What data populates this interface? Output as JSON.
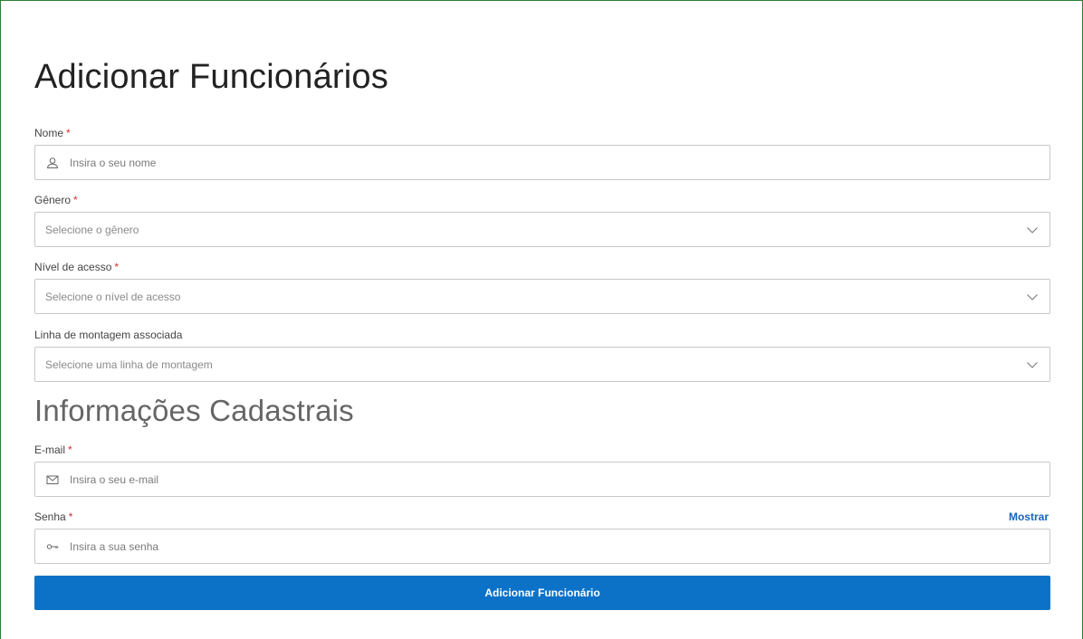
{
  "page": {
    "title": "Adicionar Funcionários",
    "section_title": "Informações Cadastrais"
  },
  "form": {
    "required_mark": "*",
    "nome": {
      "label": "Nome",
      "placeholder": "Insira o seu nome",
      "icon": "user-icon"
    },
    "genero": {
      "label": "Gênero",
      "placeholder": "Selecione o gênero",
      "icon": "chevron-down-icon"
    },
    "nivel": {
      "label": "Nível de acesso",
      "placeholder": "Selecione o nível de acesso",
      "icon": "chevron-down-icon"
    },
    "linha": {
      "label": "Linha de montagem associada",
      "placeholder": "Selecione uma linha de montagem",
      "icon": "chevron-down-icon"
    },
    "email": {
      "label": "E-mail",
      "placeholder": "Insira o seu e-mail",
      "icon": "mail-icon"
    },
    "senha": {
      "label": "Senha",
      "placeholder": "Insira a sua senha",
      "icon": "key-icon",
      "toggle_label": "Mostrar"
    },
    "submit_label": "Adicionar Funcionário"
  },
  "colors": {
    "primary": "#0b72c8",
    "required": "#d32f2f",
    "link": "#1565c0",
    "frame_border": "#2e7d32"
  }
}
